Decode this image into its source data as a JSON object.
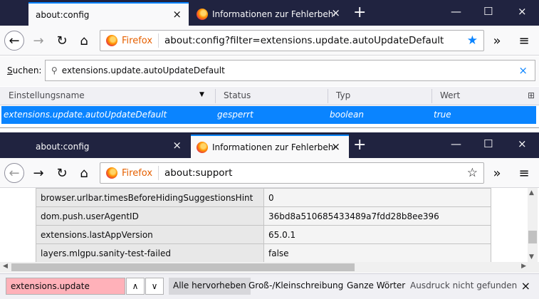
{
  "window_top": {
    "tabs": [
      {
        "title": "about:config",
        "active": true
      },
      {
        "title": "Informationen zur Fehlerbeheb",
        "active": false
      }
    ],
    "url_brand": "Firefox",
    "url": "about:config?filter=extensions.update.autoUpdateDefault",
    "search_label_prefix": "S",
    "search_label_rest": "uchen:",
    "search_value": "extensions.update.autoUpdateDefault",
    "columns": [
      "Einstellungsname",
      "Status",
      "Typ",
      "Wert"
    ],
    "rows": [
      {
        "name": "extensions.update.autoUpdateDefault",
        "status": "gesperrt",
        "type": "boolean",
        "value": "true"
      }
    ]
  },
  "window_bottom": {
    "tabs": [
      {
        "title": "about:config",
        "active": false
      },
      {
        "title": "Informationen zur Fehlerbeheb",
        "active": true
      }
    ],
    "url_brand": "Firefox",
    "url": "about:support",
    "prefs": [
      {
        "key": "browser.urlbar.timesBeforeHidingSuggestionsHint",
        "value": "0"
      },
      {
        "key": "dom.push.userAgentID",
        "value": "36bd8a510685433489a7fdd28b8ee396"
      },
      {
        "key": "extensions.lastAppVersion",
        "value": "65.0.1"
      },
      {
        "key": "layers.mlgpu.sanity-test-failed",
        "value": "false"
      }
    ],
    "findbar": {
      "query": "extensions.update",
      "highlight_all": "Alle hervorheben",
      "match_case": "Groß-/Kleinschreibung",
      "whole_words": "Ganze Wörter",
      "status": "Ausdruck nicht gefunden"
    }
  },
  "icons": {
    "close": "×",
    "new_tab": "+",
    "minimize": "—",
    "maximize": "☐",
    "back": "←",
    "forward": "→",
    "reload": "↻",
    "home": "⌂",
    "star": "★",
    "star_outline": "☆",
    "overflow": "»",
    "menu": "≡",
    "search": "⚲",
    "sort_down": "▼",
    "column_picker": "⊞",
    "find_up": "∧",
    "find_down": "∨",
    "scroll_up": "▲",
    "scroll_down": "▼",
    "scroll_left": "◀",
    "scroll_right": "▶"
  },
  "colors": {
    "tabbar": "#202340",
    "accent": "#0a84ff",
    "selection": "#0a84ff",
    "find_not_found": "#ffb1b9",
    "firefox_brand": "#e66000"
  }
}
